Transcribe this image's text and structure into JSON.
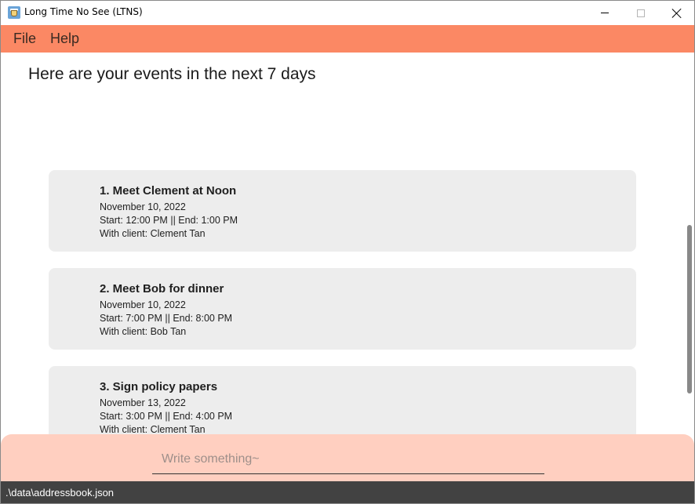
{
  "window": {
    "title": "Long Time No See (LTNS)",
    "app_icon": "coffee-cup-icon",
    "controls": [
      "minimize-icon",
      "maximize-icon",
      "close-icon"
    ]
  },
  "menu": {
    "items": [
      {
        "label": "File"
      },
      {
        "label": "Help"
      }
    ]
  },
  "main": {
    "heading": "Here are your events in the next 7 days",
    "events": [
      {
        "title": "1.  Meet Clement at Noon",
        "date": "November 10, 2022",
        "time": "Start: 12:00 PM || End: 1:00 PM",
        "client": "With client: Clement Tan"
      },
      {
        "title": "2.  Meet Bob for dinner",
        "date": "November 10, 2022",
        "time": "Start: 7:00 PM || End: 8:00 PM",
        "client": "With client: Bob Tan"
      },
      {
        "title": "3.  Sign policy papers",
        "date": "November 13, 2022",
        "time": "Start: 3:00 PM || End: 4:00 PM",
        "client": "With client: Clement Tan"
      }
    ]
  },
  "command": {
    "placeholder": "Write something~",
    "value": ""
  },
  "status": {
    "path": ".\\data\\addressbook.json"
  },
  "colors": {
    "menubar": "#fb8864",
    "command_bg": "#ffcfc0",
    "card_bg": "#ededed",
    "statusbar": "#424242"
  }
}
